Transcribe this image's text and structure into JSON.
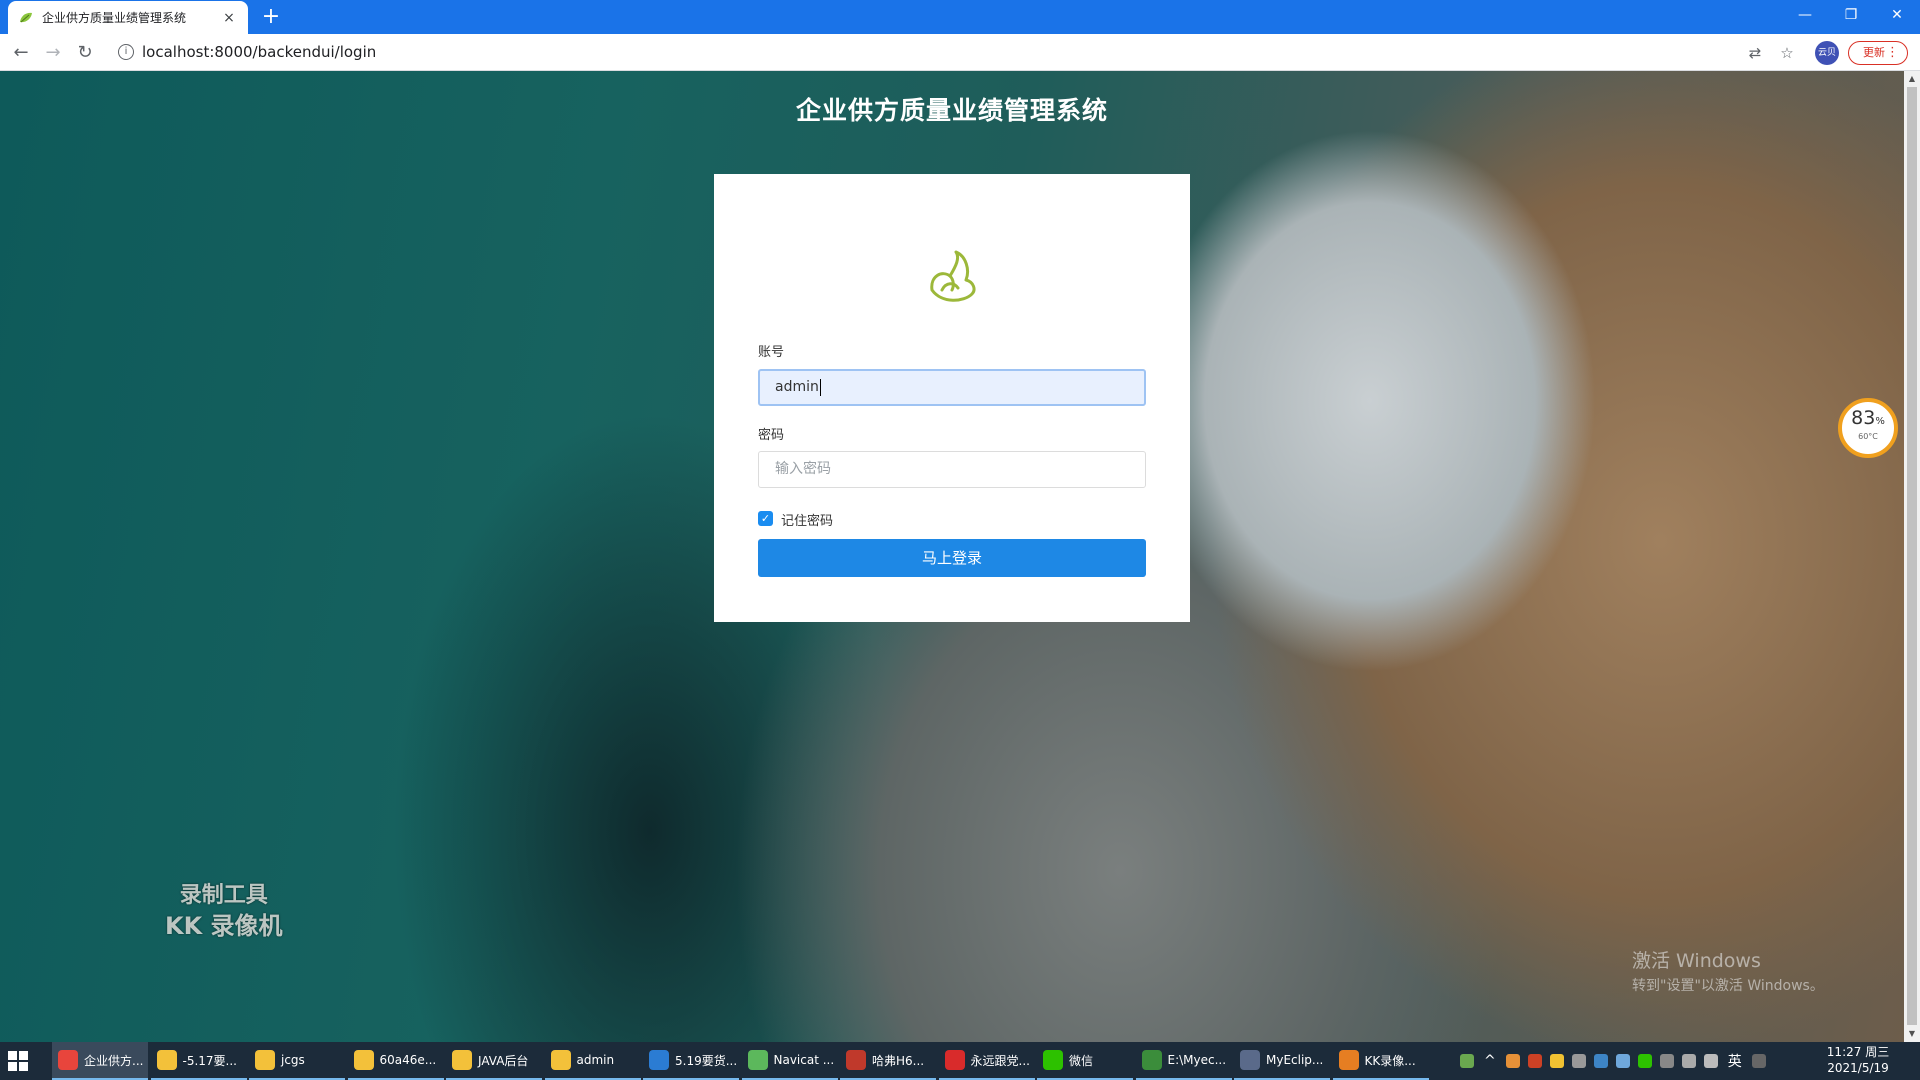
{
  "browser": {
    "tab_title": "企业供方质量业绩管理系统",
    "tab_close": "×",
    "new_tab": "+",
    "url": "localhost:8000/backendui/login",
    "update_label": "更新",
    "profile_label": "云贝",
    "window_controls": {
      "minimize": "—",
      "restore": "❐",
      "close": "✕"
    }
  },
  "page": {
    "title": "企业供方质量业绩管理系统"
  },
  "login": {
    "account_label": "账号",
    "account_value": "admin",
    "password_label": "密码",
    "password_placeholder": "输入密码",
    "remember_label": "记住密码",
    "remember_checked": true,
    "submit_label": "马上登录"
  },
  "overlay": {
    "recorder_line1": "录制工具",
    "recorder_line2": "KK 录像机",
    "activate_line1": "激活 Windows",
    "activate_line2": "转到\"设置\"以激活 Windows。",
    "gauge_value": "83",
    "gauge_unit": "%",
    "gauge_temp": "60°C"
  },
  "taskbar": {
    "items": [
      {
        "label": "企业供方...",
        "icon": "chrome-icon",
        "color": "#e8453c",
        "active": true
      },
      {
        "label": "-5.17要...",
        "icon": "folder-icon",
        "color": "#f3c13a"
      },
      {
        "label": "jcgs",
        "icon": "folder-icon",
        "color": "#f3c13a"
      },
      {
        "label": "60a46e...",
        "icon": "folder-icon",
        "color": "#f3c13a"
      },
      {
        "label": "JAVA后台",
        "icon": "folder-icon",
        "color": "#f3c13a"
      },
      {
        "label": "admin",
        "icon": "folder-icon",
        "color": "#f3c13a"
      },
      {
        "label": "5.19要货...",
        "icon": "vs-icon",
        "color": "#2b7cd3"
      },
      {
        "label": "Navicat ...",
        "icon": "navicat-icon",
        "color": "#5cb85c"
      },
      {
        "label": "哈弗H6...",
        "icon": "app-icon",
        "color": "#c0392b"
      },
      {
        "label": "永远跟党...",
        "icon": "star-icon",
        "color": "#d92b2b"
      },
      {
        "label": "微信",
        "icon": "wechat-icon",
        "color": "#2dc100"
      },
      {
        "label": "E:\\Myec...",
        "icon": "notepad-icon",
        "color": "#3b8d3b"
      },
      {
        "label": "MyEclip...",
        "icon": "eclipse-icon",
        "color": "#5a6a8a"
      },
      {
        "label": "KK录像...",
        "icon": "recorder-icon",
        "color": "#e67e22"
      }
    ],
    "ime": "英",
    "time": "11:27 周三",
    "date": "2021/5/19"
  }
}
